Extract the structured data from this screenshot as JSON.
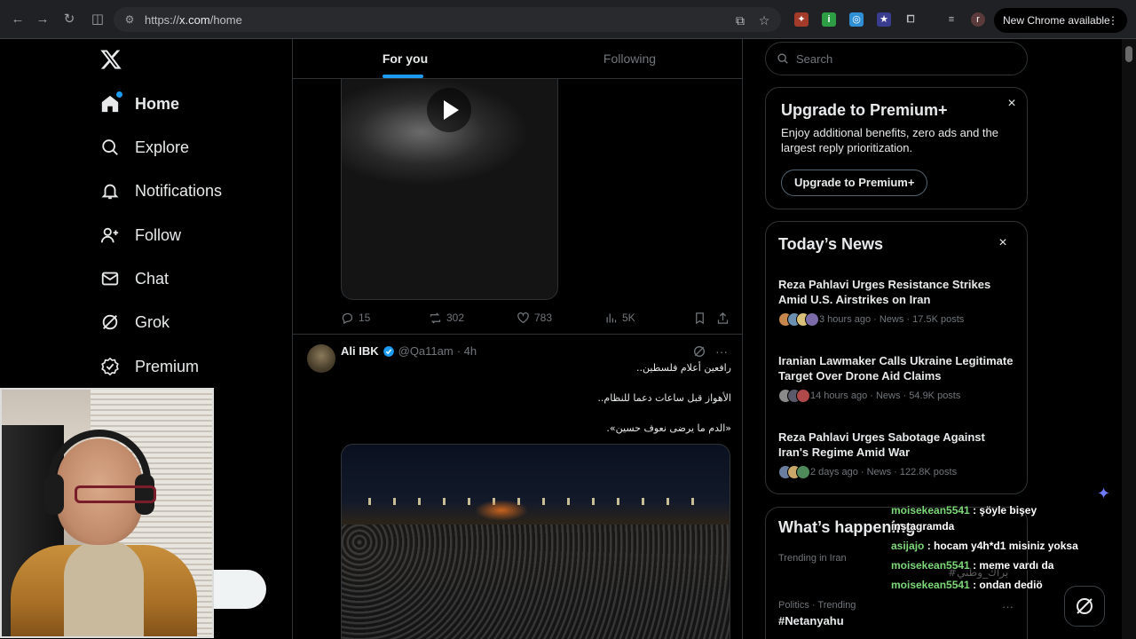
{
  "browser": {
    "url_prefix": "https://",
    "url_host": "x.com",
    "url_path": "/home",
    "update_label": "New Chrome available",
    "profile_initial": "r",
    "ext_info_letter": "i"
  },
  "nav": {
    "items": [
      {
        "label": "Home",
        "icon": "home-icon",
        "active": true
      },
      {
        "label": "Explore",
        "icon": "search-icon"
      },
      {
        "label": "Notifications",
        "icon": "bell-icon"
      },
      {
        "label": "Follow",
        "icon": "person-plus-icon"
      },
      {
        "label": "Chat",
        "icon": "envelope-icon"
      },
      {
        "label": "Grok",
        "icon": "grok-icon"
      },
      {
        "label": "Premium",
        "icon": "verified-badge-icon"
      }
    ]
  },
  "timeline": {
    "tabs": [
      {
        "label": "For you",
        "active": true
      },
      {
        "label": "Following",
        "active": false
      }
    ],
    "post1": {
      "replies": "15",
      "reposts": "302",
      "likes": "783",
      "views": "5K"
    },
    "post2": {
      "name": "Ali IBK",
      "handle": "@Qa11am",
      "time": "· 4h",
      "lines": [
        "رافعين أعلام فلسطين..",
        "الأهواز قبل ساعات دعما للنظام..",
        "«الدم ما يرضى نعوف حسين»."
      ]
    }
  },
  "sidebar": {
    "search_placeholder": "Search",
    "premium": {
      "title": "Upgrade to Premium+",
      "description": "Enjoy additional benefits, zero ads and the largest reply prioritization.",
      "button": "Upgrade to Premium+"
    },
    "news": {
      "title": "Today’s News",
      "items": [
        {
          "headline": "Reza Pahlavi Urges Resistance Strikes Amid U.S. Airstrikes on Iran",
          "meta": "3 hours ago · News · 17.5K posts"
        },
        {
          "headline": "Iranian Lawmaker Calls Ukraine Legitimate Target Over Drone Aid Claims",
          "meta": "14 hours ago · News · 54.9K posts"
        },
        {
          "headline": "Reza Pahlavi Urges Sabotage Against Iran's Regime Amid War",
          "meta": "2 days ago · News · 122.8K posts"
        }
      ]
    },
    "happening": {
      "title": "What’s happening",
      "trends": [
        {
          "label": "Trending in Iran",
          "name": ""
        },
        {
          "label": "Politics · Trending",
          "name": "#Netanyahu"
        }
      ]
    }
  },
  "stream_chat": {
    "messages": [
      {
        "user": "moisekean5541",
        "text": ": şöyle bişey"
      },
      {
        "user": "",
        "text": "instagramda"
      },
      {
        "user": "asijajo",
        "text": ": hocam y4h*d1 misiniz yoksa"
      },
      {
        "user": "moisekean5541",
        "text": ": meme vardı da"
      },
      {
        "user": "moisekean5541",
        "text": ": ondan dediö"
      }
    ],
    "faint_text": "#براك_وطني"
  },
  "colors": {
    "accent": "#1d9bf0",
    "background": "#000000",
    "border": "#2f3336",
    "secondary_text": "#71767b",
    "chat_user": "#7dd87a"
  }
}
